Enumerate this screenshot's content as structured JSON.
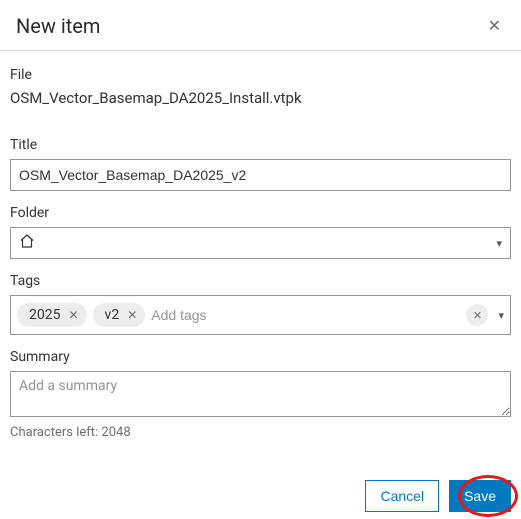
{
  "header": {
    "title": "New item"
  },
  "file": {
    "label": "File",
    "name": "OSM_Vector_Basemap_DA2025_Install.vtpk"
  },
  "title_field": {
    "label": "Title",
    "value": "OSM_Vector_Basemap_DA2025_v2"
  },
  "folder": {
    "label": "Folder",
    "selected": ""
  },
  "tags": {
    "label": "Tags",
    "items": [
      "2025",
      "v2"
    ],
    "placeholder": "Add tags"
  },
  "summary": {
    "label": "Summary",
    "placeholder": "Add a summary",
    "value": "",
    "chars_left_label": "Characters left: 2048"
  },
  "footer": {
    "cancel": "Cancel",
    "save": "Save"
  }
}
